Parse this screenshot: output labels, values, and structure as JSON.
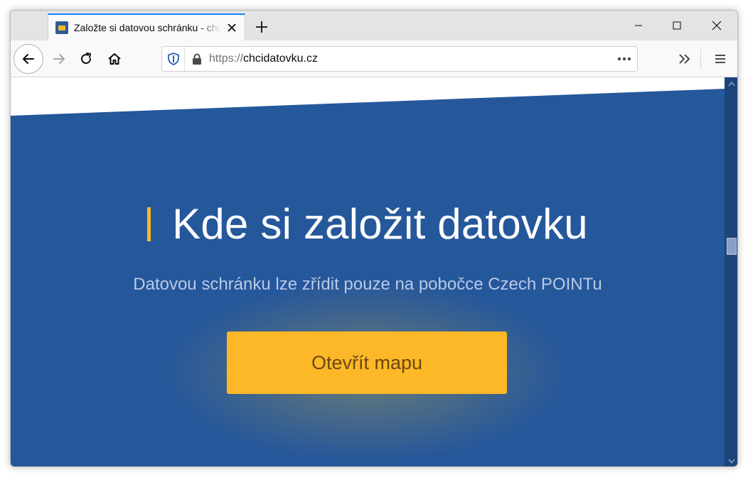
{
  "browser": {
    "tab": {
      "title": "Založte si datovou schránku - chcidatovku.cz",
      "favicon": "datovka-favicon-icon"
    },
    "url": {
      "scheme": "https://",
      "host": "chcidatovku.cz"
    },
    "icons": [
      "arrow-left-icon",
      "arrow-right-icon",
      "reload-icon",
      "home-icon",
      "shield-icon",
      "lock-icon",
      "more-icon",
      "chevrons-right-icon",
      "menu-icon",
      "plus-icon",
      "close-icon",
      "minimize-icon",
      "maximize-icon"
    ]
  },
  "page": {
    "heading": "Kde si založit datovku",
    "subtitle": "Datovou schránku lze zřídit pouze na pobočce Czech POINTu",
    "cta_label": "Otevřít mapu"
  },
  "colors": {
    "background_blue": "#25579b",
    "accent_yellow": "#fdb827",
    "subtitle_text": "#b9c9e6",
    "button_text": "#6b4712",
    "scrollbar": "#1c4479"
  }
}
